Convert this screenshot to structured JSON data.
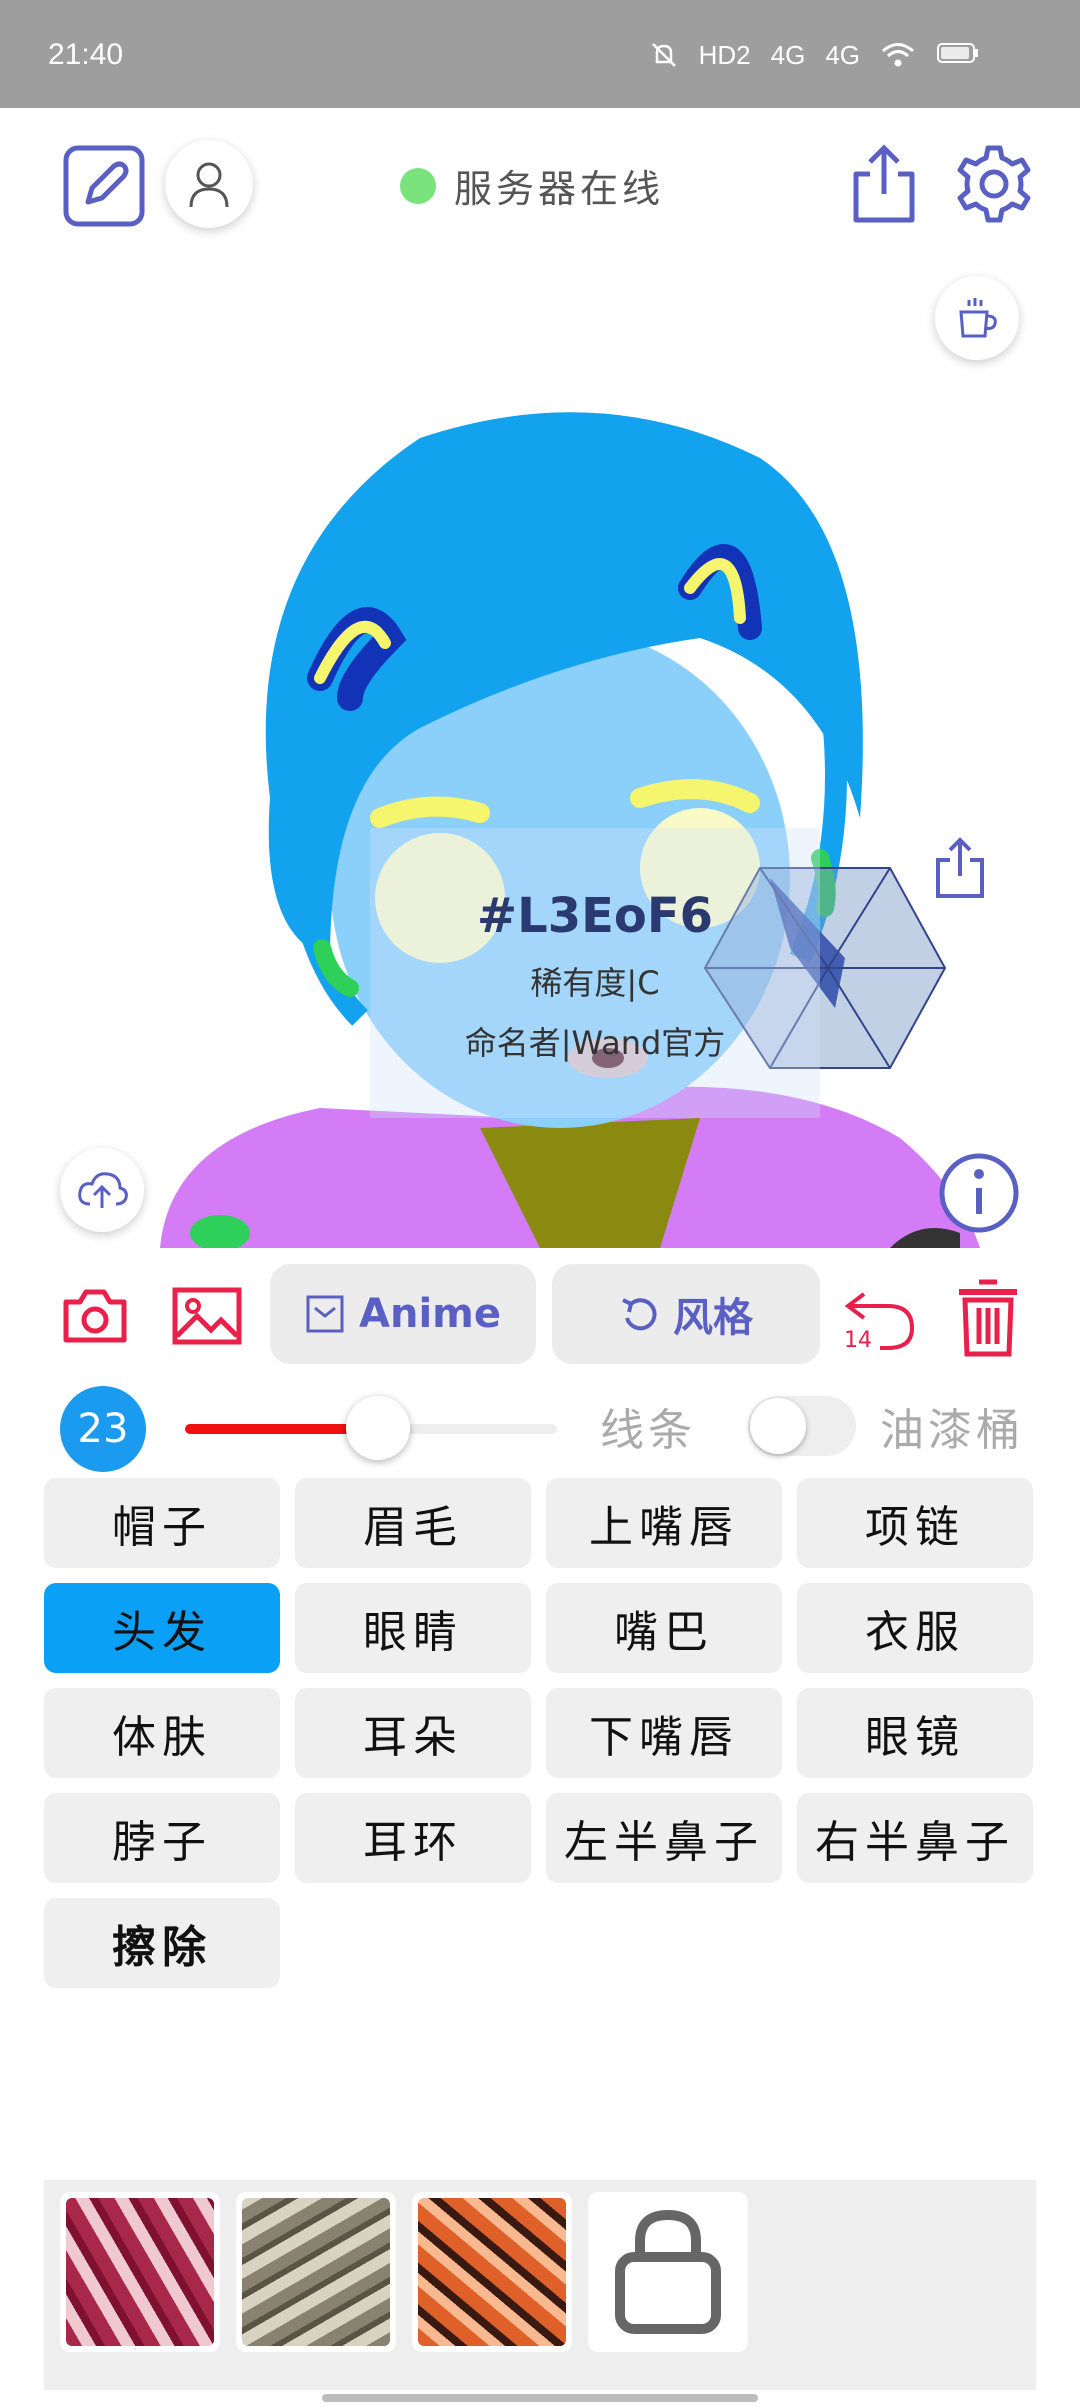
{
  "status_bar": {
    "time": "21:40",
    "icons": [
      "mute-icon",
      "hd-icon",
      "signal-4g-icon",
      "signal-4g-icon",
      "wifi-icon",
      "battery-icon"
    ],
    "hd_label": "HD2",
    "net1": "4G",
    "net2": "4G"
  },
  "header": {
    "server_status": "服务器在线",
    "status_color": "#7be37b"
  },
  "canvas_card": {
    "id": "#L3EoF6",
    "rarity": "稀有度|C",
    "namer": "命名者|Wand官方"
  },
  "toolbar": {
    "anime_label": "Anime",
    "style_label": "风格",
    "undo_count": "14",
    "accent": "#5a5fc4",
    "danger": "#e8204a"
  },
  "brush": {
    "size": "23",
    "level": 0.45,
    "line_label": "线条",
    "bucket_label": "油漆桶"
  },
  "parts": [
    {
      "label": "帽子",
      "active": false
    },
    {
      "label": "眉毛",
      "active": false
    },
    {
      "label": "上嘴唇",
      "active": false
    },
    {
      "label": "项链",
      "active": false
    },
    {
      "label": "头发",
      "active": true
    },
    {
      "label": "眼睛",
      "active": false
    },
    {
      "label": "嘴巴",
      "active": false
    },
    {
      "label": "衣服",
      "active": false
    },
    {
      "label": "体肤",
      "active": false
    },
    {
      "label": "耳朵",
      "active": false
    },
    {
      "label": "下嘴唇",
      "active": false
    },
    {
      "label": "眼镜",
      "active": false
    },
    {
      "label": "脖子",
      "active": false
    },
    {
      "label": "耳环",
      "active": false
    },
    {
      "label": "左半鼻子",
      "active": false
    },
    {
      "label": "右半鼻子",
      "active": false
    },
    {
      "label": "擦除",
      "active": false
    }
  ],
  "style_tray": {
    "thumbnails": [
      "style-red-texture",
      "style-beige-texture",
      "style-orange-texture"
    ],
    "locked_icon": "lock-icon"
  }
}
